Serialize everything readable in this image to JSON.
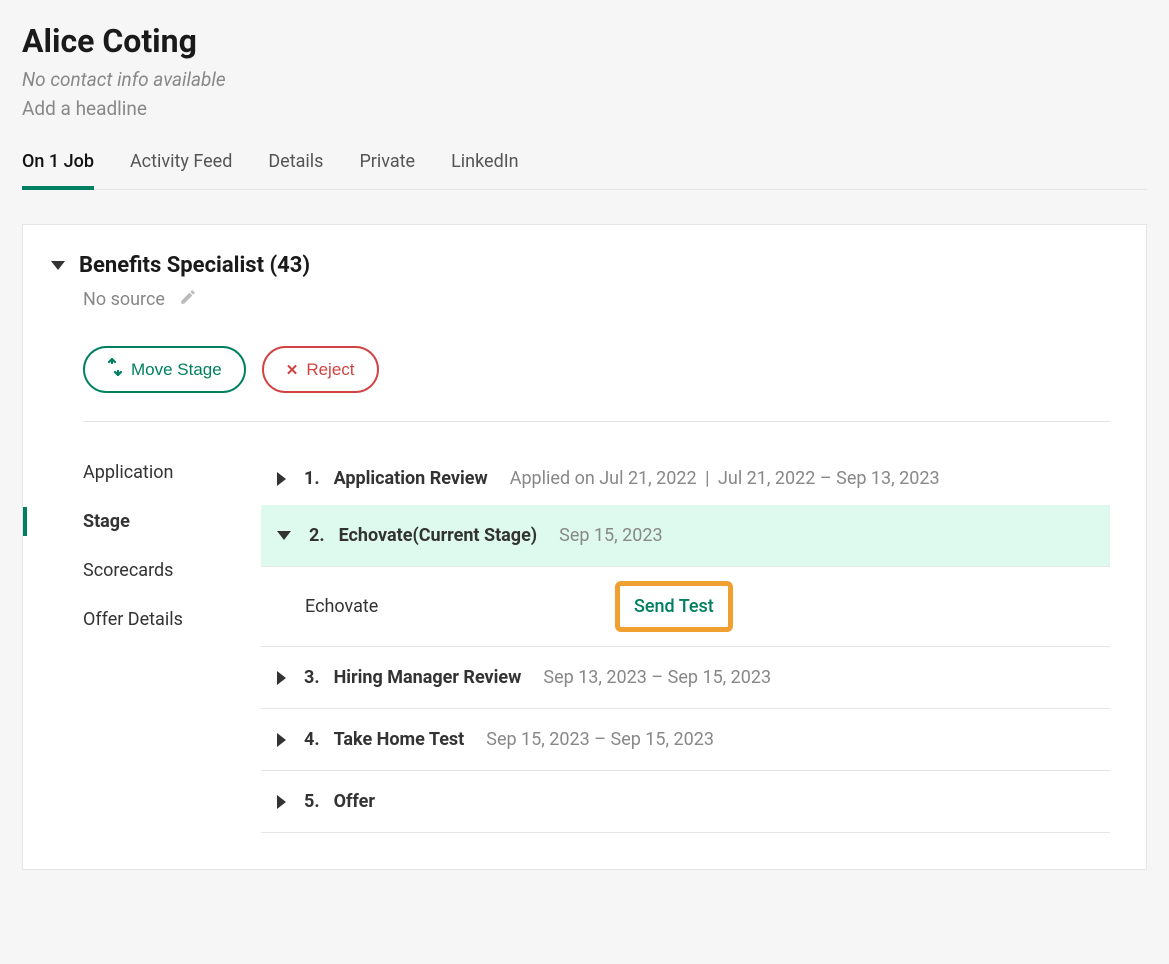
{
  "candidate": {
    "name": "Alice Coting",
    "contact_info": "No contact info available",
    "headline": "Add a headline"
  },
  "tabs": [
    {
      "label": "On 1 Job",
      "active": true
    },
    {
      "label": "Activity Feed",
      "active": false
    },
    {
      "label": "Details",
      "active": false
    },
    {
      "label": "Private",
      "active": false
    },
    {
      "label": "LinkedIn",
      "active": false
    }
  ],
  "job": {
    "title": "Benefits Specialist (43)",
    "source": "No source",
    "buttons": {
      "move_stage": "Move Stage",
      "reject": "Reject"
    }
  },
  "sidebar": {
    "items": [
      {
        "label": "Application",
        "active": false
      },
      {
        "label": "Stage",
        "active": true
      },
      {
        "label": "Scorecards",
        "active": false
      },
      {
        "label": "Offer Details",
        "active": false
      }
    ]
  },
  "stages": [
    {
      "num": "1.",
      "name": "Application Review",
      "meta_prefix": "Applied on Jul 21, 2022",
      "meta_range": "Jul 21, 2022 – Sep 13, 2023",
      "expanded": false
    },
    {
      "num": "2.",
      "name": "Echovate",
      "name_suffix": "(Current Stage)",
      "meta": "Sep 15, 2023",
      "expanded": true,
      "current": true,
      "sub": {
        "name": "Echovate",
        "action": "Send Test"
      }
    },
    {
      "num": "3.",
      "name": "Hiring Manager Review",
      "meta": "Sep 13, 2023 – Sep 15, 2023",
      "expanded": false
    },
    {
      "num": "4.",
      "name": "Take Home Test",
      "meta": "Sep 15, 2023 – Sep 15, 2023",
      "expanded": false
    },
    {
      "num": "5.",
      "name": "Offer",
      "meta": "",
      "expanded": false
    }
  ]
}
